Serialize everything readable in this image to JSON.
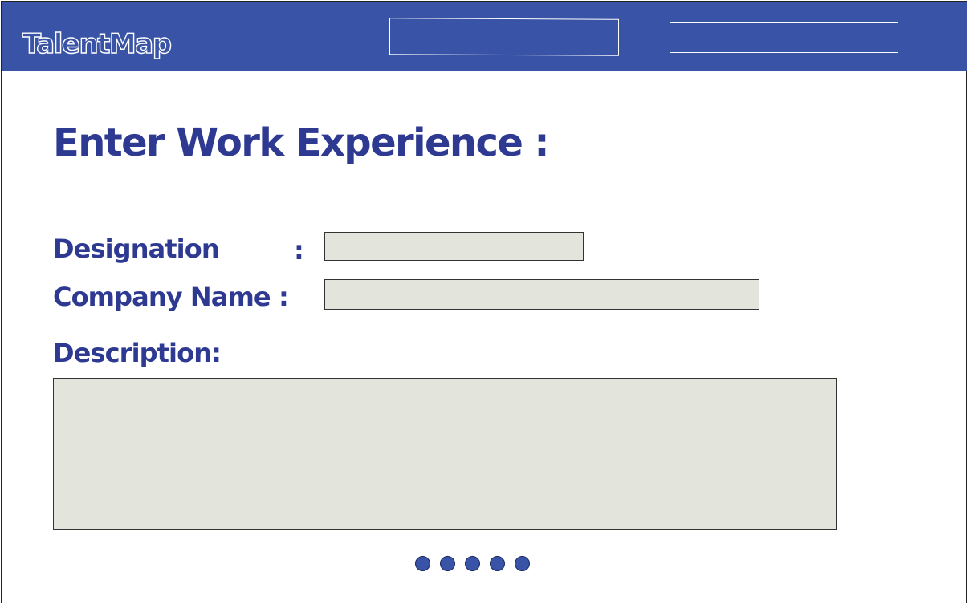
{
  "header": {
    "logo_text": "TalentMap",
    "background_color": "#3953a6",
    "nav_boxes": [
      "",
      ""
    ]
  },
  "form": {
    "title": "Enter Work Experience :",
    "designation_label": "Designation",
    "designation_colon": ":",
    "designation_value": "",
    "company_label": "Company Name :",
    "company_value": "",
    "description_label": "Description:",
    "description_value": "",
    "field_color": "#e3e4dc",
    "text_color": "#2e3a91"
  },
  "pagination": {
    "dot_count": 5,
    "dot_color": "#3953a6"
  }
}
